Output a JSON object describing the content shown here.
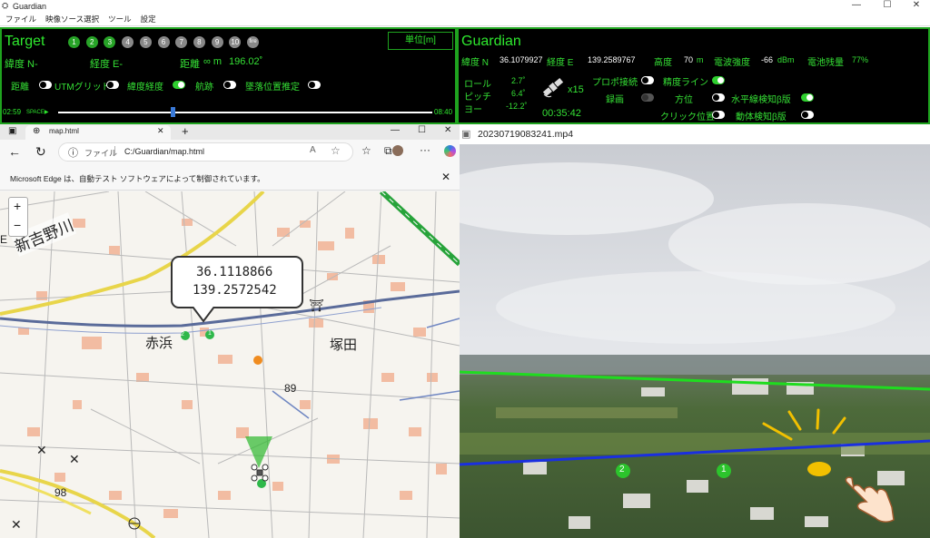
{
  "window": {
    "title": "Guardian",
    "min": "—",
    "max": "☐",
    "close": "✕"
  },
  "menu": [
    "ファイル",
    "映像ソース選択",
    "ツール",
    "設定"
  ],
  "target": {
    "title": "Target",
    "circles": [
      "1",
      "2",
      "3",
      "4",
      "5",
      "6",
      "7",
      "8",
      "9",
      "10",
      "fire"
    ],
    "unit_button": "単位[m]",
    "lat_label": "緯度 N-",
    "lon_label": "経度 E-",
    "dist_label": "距離",
    "dist_value": "∞ m",
    "bearing": "196.02˚",
    "toggles": [
      {
        "label": "距離",
        "on": false
      },
      {
        "label": "UTMグリッド",
        "on": false
      },
      {
        "label": "緯度経度",
        "on": true
      },
      {
        "label": "航跡",
        "on": false
      },
      {
        "label": "墜落位置推定",
        "on": false
      }
    ],
    "time_start": "02:59",
    "space_hint": "SPACE▶",
    "time_end": "08:40",
    "seek_fraction": 0.3
  },
  "guardian": {
    "title": "Guardian",
    "lat": "緯度 N",
    "lat_value": "36.1079927",
    "lon": "経度 E",
    "lon_value": "139.2589767",
    "alt": "高度",
    "alt_value": "70",
    "alt_unit": "m",
    "signal": "電波強度",
    "signal_value": "-66",
    "signal_unit": "dBm",
    "battery": "電池残量",
    "battery_value": "77%",
    "roll": "ロール",
    "roll_value": "2.7˚",
    "pitch": "ピッチ",
    "pitch_value": "6.4˚",
    "yaw": "ヨー",
    "yaw_value": "-12.2˚",
    "sat_count": "x15",
    "elapsed": "00:35:42",
    "toggles": [
      {
        "label": "プロポ接続",
        "on": false
      },
      {
        "label": "精度ライン",
        "on": true
      },
      {
        "label": "録画",
        "on": false,
        "disabled": true
      },
      {
        "label": "方位",
        "on": false
      },
      {
        "label": "水平線検知β版",
        "on": true
      },
      {
        "label": "クリック位置",
        "on": false
      },
      {
        "label": "動体検知β版",
        "on": false
      }
    ]
  },
  "browser": {
    "tab_title": "map.html",
    "address_prefix": "ファイル",
    "address": "C:/Guardian/map.html",
    "notice": "Microsoft Edge は、自動テスト ソフトウェアによって制御されています。",
    "zoom_in": "+",
    "zoom_out": "−",
    "popup_lat": "36.1118866",
    "popup_lon": "139.2572542",
    "map_labels": [
      "新吉野川",
      "赤浜",
      "塚田",
      "89",
      "98",
      "E"
    ]
  },
  "video": {
    "filename": "20230719083241.mp4",
    "markers": [
      "2",
      "1"
    ]
  },
  "colors": {
    "accent": "#29d629",
    "panel_border": "#1fa31f",
    "horizon": "#1fdc1f",
    "precision_line": "#1a2fe0",
    "marker": "#2cc42c"
  }
}
